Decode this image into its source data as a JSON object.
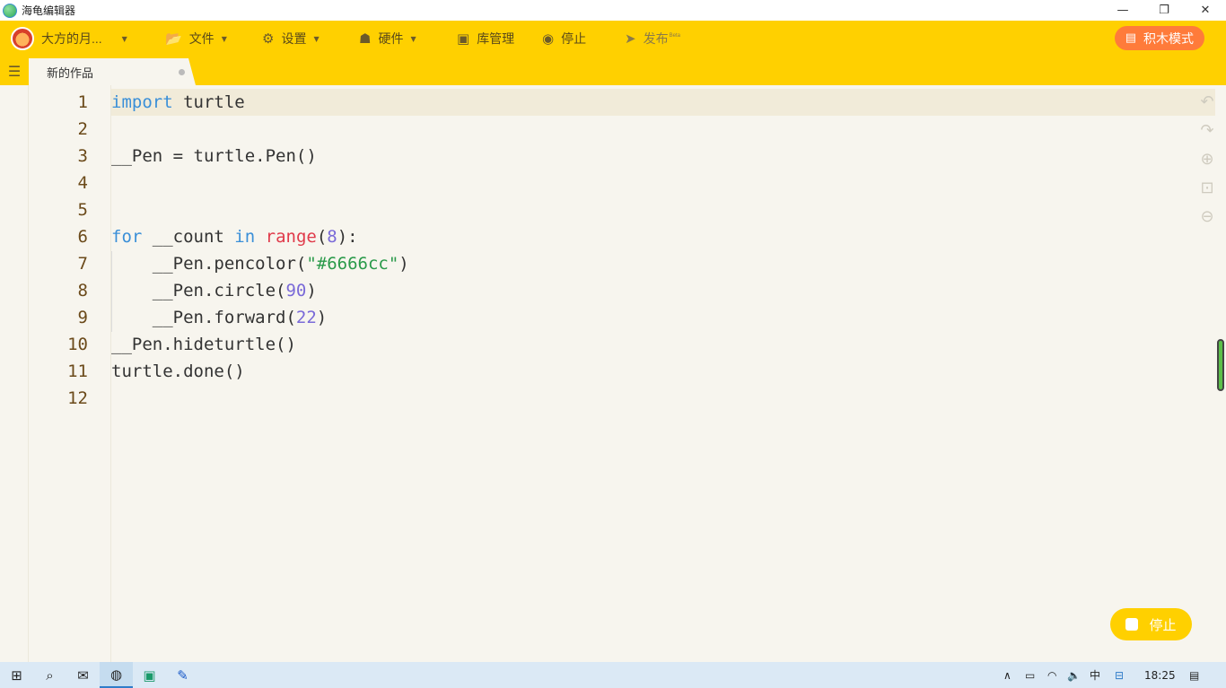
{
  "window": {
    "title": "海龟编辑器",
    "controls": [
      "—",
      "❐",
      "✕"
    ]
  },
  "toolbar": {
    "user": {
      "name": "大方的月..."
    },
    "file_label": "文件",
    "settings_label": "设置",
    "hardware_label": "硬件",
    "library_label": "库管理",
    "stop_label": "停止",
    "publish_label": "发布",
    "publish_badge": "Beta",
    "mode_button_label": "积木模式"
  },
  "tabs": [
    {
      "label": "新的作品",
      "modified": true
    }
  ],
  "editor": {
    "line_numbers": [
      "1",
      "2",
      "3",
      "4",
      "5",
      "6",
      "7",
      "8",
      "9",
      "10",
      "11",
      "12"
    ],
    "current_line": 1,
    "lines": [
      "import turtle",
      "",
      "__Pen = turtle.Pen()",
      "",
      "",
      "for __count in range(8):",
      "    __Pen.pencolor(\"#6666cc\")",
      "    __Pen.circle(90)",
      "    __Pen.forward(22)",
      "__Pen.hideturtle()",
      "turtle.done()",
      ""
    ],
    "tokens": {
      "l1_kw": "import",
      "l1_rest": " turtle",
      "l3": "__Pen = turtle.Pen()",
      "l6_kw1": "for",
      "l6_a": " __count ",
      "l6_kw2": "in",
      "l6_sp": " ",
      "l6_fn": "range",
      "l6_p1": "(",
      "l6_num": "8",
      "l6_p2": "):",
      "l7_a": "    __Pen.pencolor(",
      "l7_str": "\"#6666cc\"",
      "l7_b": ")",
      "l8_a": "    __Pen.circle(",
      "l8_num": "90",
      "l8_b": ")",
      "l9_a": "    __Pen.forward(",
      "l9_num": "22",
      "l9_b": ")",
      "l10": "__Pen.hideturtle()",
      "l11": "turtle.done()"
    },
    "colors": {
      "keyword": "#3a8fd8",
      "builtin": "#e03a4a",
      "number": "#7a6ad8",
      "string": "#2a9a4a",
      "accent": "#ffd000"
    }
  },
  "run_button": {
    "label": "停止"
  },
  "taskbar": {
    "clock": "18:25",
    "ime": "中"
  }
}
